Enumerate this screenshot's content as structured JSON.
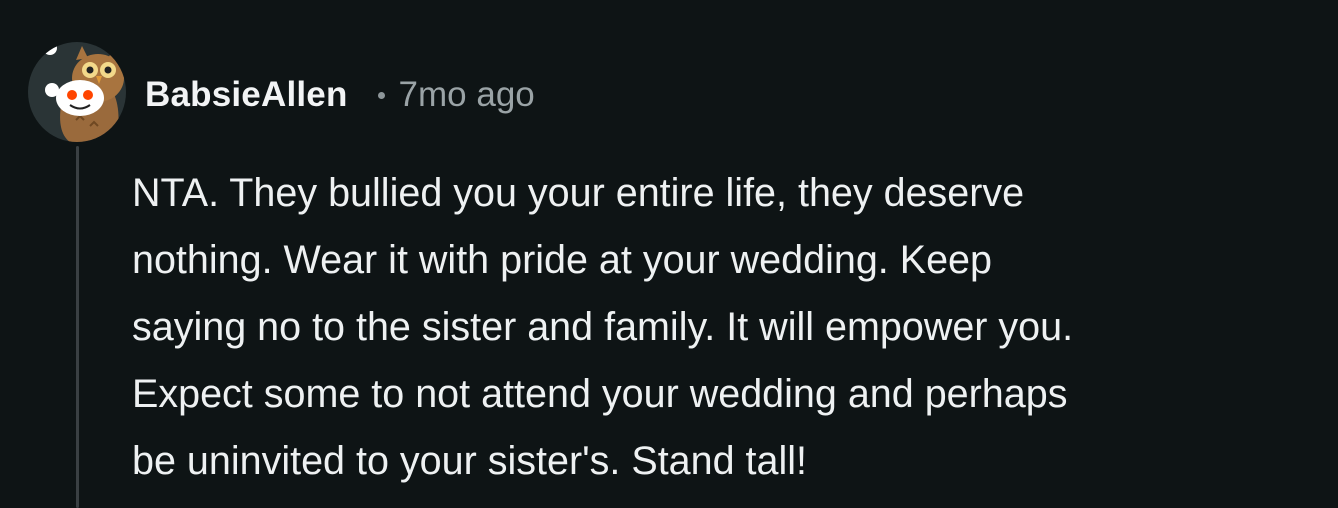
{
  "comment": {
    "author": "BabsieAllen",
    "timestamp": "7mo ago",
    "avatar_icon": "snoo-owl-costume-icon",
    "body_lines": [
      "NTA. They bullied you your entire life, they deserve",
      "nothing. Wear it with pride at your wedding. Keep",
      "saying no to the sister and family. It will empower you.",
      "Expect some to not attend your wedding and perhaps",
      "be uninvited to your sister's. Stand tall!"
    ]
  },
  "colors": {
    "background": "#0e1415",
    "thread_line": "#3a4043",
    "text": "#eef1f2",
    "meta": "#9aa3a6"
  }
}
